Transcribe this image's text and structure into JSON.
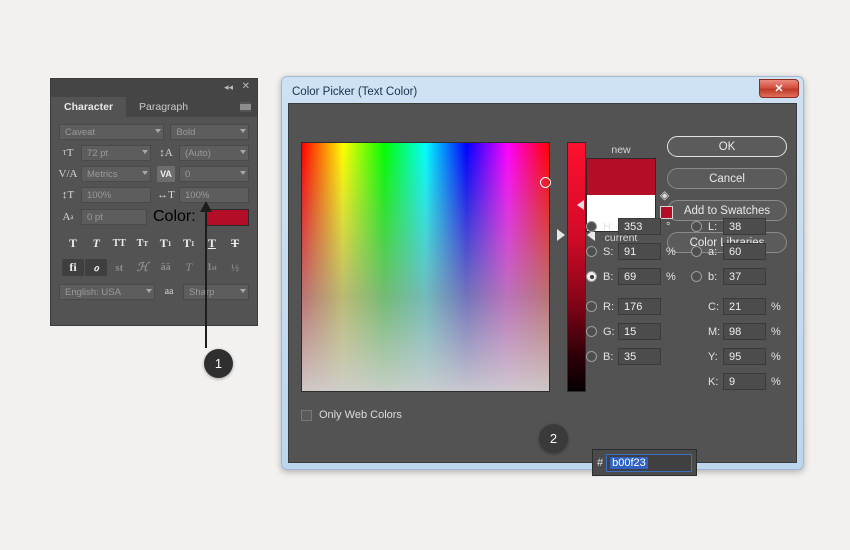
{
  "character_panel": {
    "tabs": [
      {
        "label": "Character",
        "active": true
      },
      {
        "label": "Paragraph",
        "active": false
      }
    ],
    "icons": {
      "collapse": "collapse-arrows-icon",
      "close": "close-icon",
      "menu": "panel-menu-icon"
    },
    "font_family": "Caveat",
    "font_style": "Bold",
    "font_size_label": "size-icon",
    "font_size": "72 pt",
    "leading_label": "leading-icon",
    "leading": "(Auto)",
    "kerning_label": "V/A",
    "kerning": "Metrics",
    "tracking_label": "VA",
    "tracking": "0",
    "vertical_scale_label": "vertical-scale-icon",
    "vertical_scale": "100%",
    "horizontal_scale_label": "horizontal-scale-icon",
    "horizontal_scale": "100%",
    "baseline_label": "baseline-shift-icon",
    "baseline_shift": "0 pt",
    "color_label": "Color:",
    "color_value": "#b30d27",
    "style_buttons": [
      {
        "name": "faux-bold",
        "glyph": "T",
        "state": "normal"
      },
      {
        "name": "faux-italic",
        "glyph": "T",
        "state": "italic"
      },
      {
        "name": "all-caps",
        "glyph": "TT",
        "state": "normal"
      },
      {
        "name": "small-caps",
        "glyph": "Tт",
        "state": "normal"
      },
      {
        "name": "superscript",
        "glyph": "T¹",
        "state": "normal"
      },
      {
        "name": "subscript",
        "glyph": "T₁",
        "state": "normal"
      },
      {
        "name": "underline",
        "glyph": "T",
        "state": "underline"
      },
      {
        "name": "strikethrough",
        "glyph": "T",
        "state": "strike"
      }
    ],
    "opentype_buttons": [
      {
        "name": "standard-ligatures",
        "glyph": "fi",
        "enabled": true
      },
      {
        "name": "contextual-alternates",
        "glyph": "℘",
        "enabled": true
      },
      {
        "name": "discretionary-ligatures",
        "glyph": "st",
        "enabled": false
      },
      {
        "name": "swash",
        "glyph": "ℋ",
        "enabled": false
      },
      {
        "name": "oldstyle",
        "glyph": "aa",
        "enabled": false
      },
      {
        "name": "titling-alternates",
        "glyph": "T",
        "enabled": false
      },
      {
        "name": "ordinals",
        "glyph": "1ˢᵗ",
        "enabled": false
      },
      {
        "name": "fractions",
        "glyph": "½",
        "enabled": false
      }
    ],
    "language": "English: USA",
    "antialias_icon": "aa",
    "antialias": "Sharp"
  },
  "dialog": {
    "title": "Color Picker (Text Color)",
    "close_label": "✕",
    "buttons": [
      {
        "label": "OK",
        "primary": true
      },
      {
        "label": "Cancel",
        "primary": false
      },
      {
        "label": "Add to Swatches",
        "primary": false
      },
      {
        "label": "Color Libraries",
        "primary": false
      }
    ],
    "preview": {
      "new_label": "new",
      "current_label": "current",
      "new_color": "#b30d27",
      "current_color": "#ffffff",
      "gamut_warning_icon": "out-of-gamut-cube-icon",
      "websafe_icon": "web-safe-warning-icon"
    },
    "only_web_colors": {
      "label": "Only Web Colors",
      "checked": false
    },
    "fields": {
      "hsb": [
        {
          "key": "H:",
          "value": "353",
          "unit": "°",
          "selected": false
        },
        {
          "key": "S:",
          "value": "91",
          "unit": "%",
          "selected": false
        },
        {
          "key": "B:",
          "value": "69",
          "unit": "%",
          "selected": true
        }
      ],
      "lab": [
        {
          "key": "L:",
          "value": "38",
          "unit": "",
          "selected": false
        },
        {
          "key": "a:",
          "value": "60",
          "unit": "",
          "selected": false
        },
        {
          "key": "b:",
          "value": "37",
          "unit": "",
          "selected": false
        }
      ],
      "rgb": [
        {
          "key": "R:",
          "value": "176",
          "unit": "",
          "selected": false
        },
        {
          "key": "G:",
          "value": "15",
          "unit": "",
          "selected": false
        },
        {
          "key": "B:",
          "value": "35",
          "unit": "",
          "selected": false
        }
      ],
      "cmyk": [
        {
          "key": "C:",
          "value": "21",
          "unit": "%"
        },
        {
          "key": "M:",
          "value": "98",
          "unit": "%"
        },
        {
          "key": "Y:",
          "value": "95",
          "unit": "%"
        },
        {
          "key": "K:",
          "value": "9",
          "unit": "%"
        }
      ]
    },
    "hex": {
      "hash": "#",
      "value": "b00f23"
    }
  },
  "callouts": [
    {
      "number": "1"
    },
    {
      "number": "2"
    }
  ]
}
